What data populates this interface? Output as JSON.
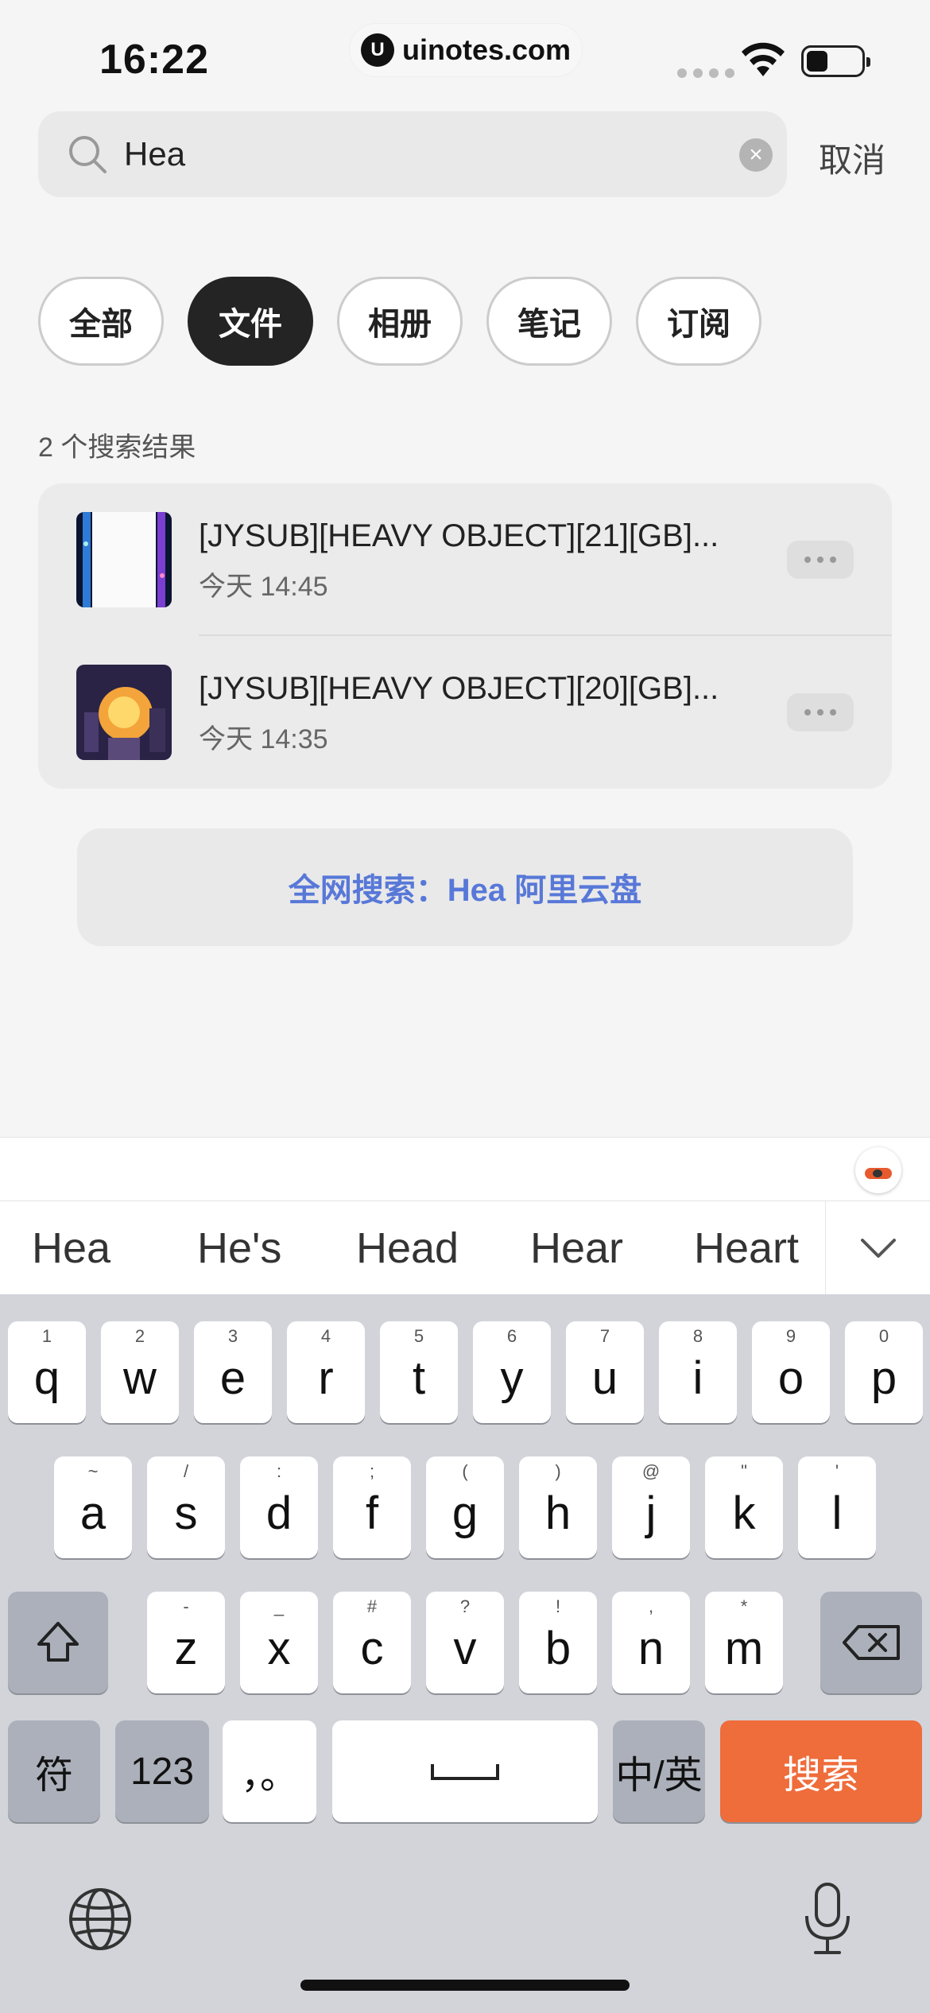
{
  "status_bar": {
    "time": "16:22",
    "brand": "uinotes.com",
    "brand_logo": "U"
  },
  "search": {
    "query": "Hea",
    "clear_label": "×",
    "cancel_label": "取消"
  },
  "filters": [
    {
      "label": "全部",
      "active": false
    },
    {
      "label": "文件",
      "active": true
    },
    {
      "label": "相册",
      "active": false
    },
    {
      "label": "笔记",
      "active": false
    },
    {
      "label": "订阅",
      "active": false
    }
  ],
  "results": {
    "count_label": "2 个搜索结果",
    "items": [
      {
        "title": "[JYSUB][HEAVY OBJECT][21][GB]...",
        "date": "今天 14:45",
        "thumb_icon": "video-thumbnail-dark"
      },
      {
        "title": "[JYSUB][HEAVY OBJECT][20][GB]...",
        "date": "今天 14:35",
        "thumb_icon": "video-thumbnail-anime"
      }
    ]
  },
  "web_search_label": "全网搜索：Hea 阿里云盘",
  "keyboard": {
    "suggestions": [
      "Hea",
      "He's",
      "Head",
      "Hear",
      "Heart"
    ],
    "row1": [
      {
        "hint": "1",
        "key": "q"
      },
      {
        "hint": "2",
        "key": "w"
      },
      {
        "hint": "3",
        "key": "e"
      },
      {
        "hint": "4",
        "key": "r"
      },
      {
        "hint": "5",
        "key": "t"
      },
      {
        "hint": "6",
        "key": "y"
      },
      {
        "hint": "7",
        "key": "u"
      },
      {
        "hint": "8",
        "key": "i"
      },
      {
        "hint": "9",
        "key": "o"
      },
      {
        "hint": "0",
        "key": "p"
      }
    ],
    "row2": [
      {
        "hint": "~",
        "key": "a"
      },
      {
        "hint": "/",
        "key": "s"
      },
      {
        "hint": ":",
        "key": "d"
      },
      {
        "hint": ";",
        "key": "f"
      },
      {
        "hint": "(",
        "key": "g"
      },
      {
        "hint": ")",
        "key": "h"
      },
      {
        "hint": "@",
        "key": "j"
      },
      {
        "hint": "\"",
        "key": "k"
      },
      {
        "hint": "'",
        "key": "l"
      }
    ],
    "row3": [
      {
        "hint": "-",
        "key": "z"
      },
      {
        "hint": "_",
        "key": "x"
      },
      {
        "hint": "#",
        "key": "c"
      },
      {
        "hint": "?",
        "key": "v"
      },
      {
        "hint": "!",
        "key": "b"
      },
      {
        "hint": ",",
        "key": "n"
      },
      {
        "hint": "*",
        "key": "m"
      }
    ],
    "symbols_label": "符",
    "numbers_label": "123",
    "punct_label": "，。",
    "lang_label": "中/英",
    "search_label": "搜索",
    "accent": "#ef6c3b"
  }
}
